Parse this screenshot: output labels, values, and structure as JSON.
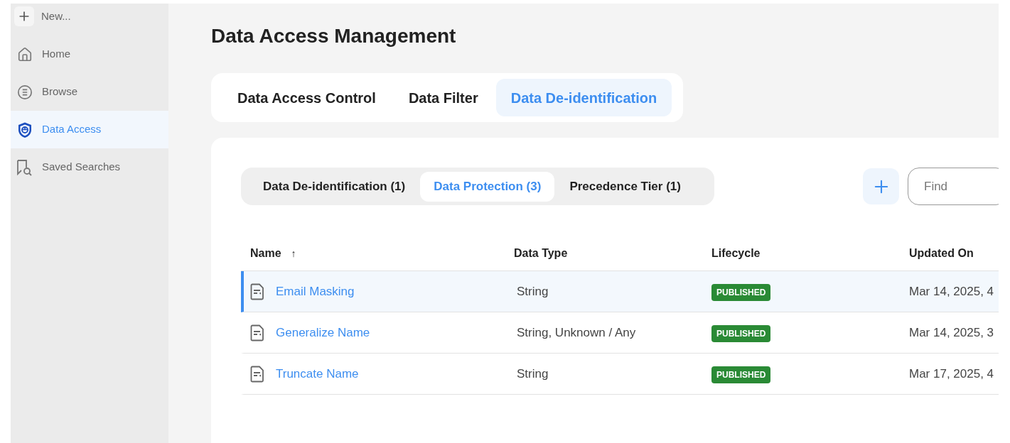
{
  "sidebar": {
    "new_button": {
      "label": "New..."
    },
    "items": [
      {
        "label": "Home",
        "selected": false
      },
      {
        "label": "Browse",
        "selected": false
      },
      {
        "label": "Data Access",
        "selected": true
      },
      {
        "label": "Saved Searches",
        "selected": false
      }
    ]
  },
  "page_title": "Data Access Management",
  "tabs": [
    {
      "label": "Data Access Control",
      "selected": false
    },
    {
      "label": "Data Filter",
      "selected": false
    },
    {
      "label": "Data De-identification",
      "selected": true
    }
  ],
  "subtabs": [
    {
      "label": "Data De-identification (1)",
      "selected": false
    },
    {
      "label": "Data Protection (3)",
      "selected": true
    },
    {
      "label": "Precedence Tier (1)",
      "selected": false
    }
  ],
  "find": {
    "placeholder": "Find"
  },
  "table": {
    "columns": [
      {
        "label": "Name",
        "sort": "↑"
      },
      {
        "label": "Data Type"
      },
      {
        "label": "Lifecycle"
      },
      {
        "label": "Updated On"
      }
    ],
    "rows": [
      {
        "name": "Email Masking",
        "data_type": "String",
        "lifecycle": "PUBLISHED",
        "updated_on": "Mar 14, 2025, 4",
        "selected": true
      },
      {
        "name": "Generalize Name",
        "data_type": "String, Unknown / Any",
        "lifecycle": "PUBLISHED",
        "updated_on": "Mar 14, 2025, 3",
        "selected": false
      },
      {
        "name": "Truncate Name",
        "data_type": "String",
        "lifecycle": "PUBLISHED",
        "updated_on": "Mar 17, 2025, 4",
        "selected": false
      }
    ]
  }
}
